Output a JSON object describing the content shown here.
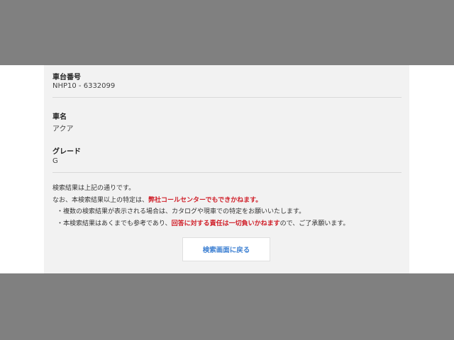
{
  "result": {
    "chassis": {
      "label": "車台番号",
      "value": "NHP10 - 6332099"
    },
    "car_name": {
      "label": "車名",
      "value": "アクア"
    },
    "grade": {
      "label": "グレード",
      "value": "G"
    }
  },
  "notes": {
    "line1": "検索結果は上記の通りです。",
    "line2_prefix": "なお、本検索結果以上の特定は、",
    "line2_emphasis": "弊社コールセンターでもできかねます。",
    "line3": "・複数の検索結果が表示される場合は、カタログや現車での特定をお願いいたします。",
    "line4_prefix": "・本検索結果はあくまでも参考であり、",
    "line4_emphasis": "回答に対する責任は一切負いかねます",
    "line4_suffix": "ので、ご了承願います。"
  },
  "actions": {
    "back_label": "検索画面に戻る"
  },
  "colors": {
    "emphasis": "#d0202a",
    "link": "#3c7fd2",
    "backdrop": "#808080",
    "panel": "#f2f2f2"
  }
}
